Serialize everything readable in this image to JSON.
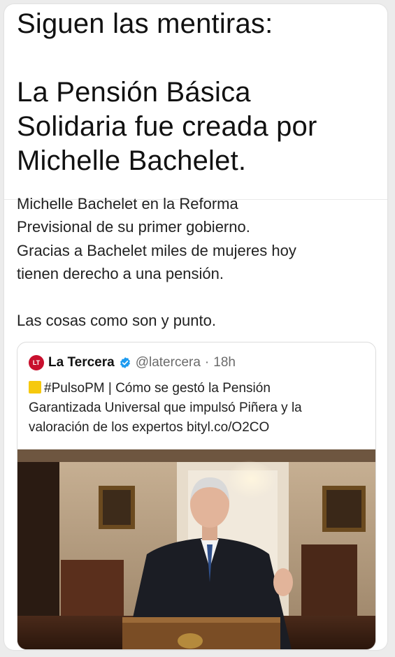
{
  "headline": {
    "lines": [
      "Siguen las mentiras:",
      "",
      "La Pensión Básica",
      "Solidaria fue creada por",
      "Michelle Bachelet."
    ]
  },
  "tweet": {
    "lines": [
      "Michelle Bachelet en la Reforma",
      "Previsional de su primer gobierno.",
      "Gracias a Bachelet miles de mujeres hoy",
      "tienen derecho a una pensión.",
      "",
      "Las cosas como son y punto."
    ]
  },
  "quote": {
    "avatar_text": "LT",
    "name": "La Tercera",
    "handle": "@latercera",
    "separator": "·",
    "time": "18h",
    "text_lines": [
      "#PulsoPM | Cómo se gestó la Pensión",
      "Garantizada Universal que impulsó Piñera y la",
      "valoración de los expertos bityl.co/O2CO"
    ],
    "image_alt": "Sebastián Piñera speaking at a wooden podium in a formal room"
  },
  "colors": {
    "avatar": "#c8102e",
    "verified": "#1d9bf0",
    "emoji": "#f6c90e"
  }
}
